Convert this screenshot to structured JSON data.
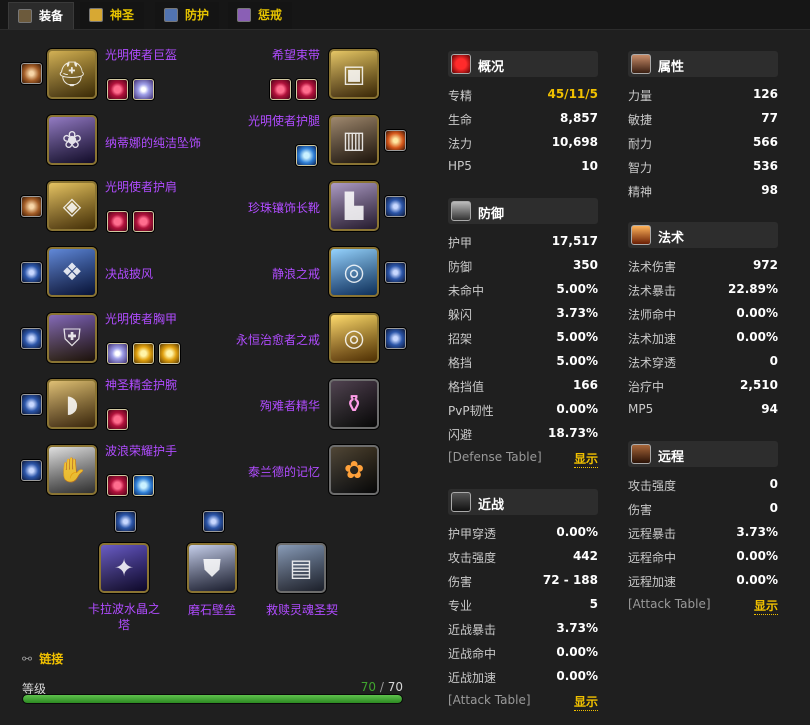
{
  "tabs": [
    {
      "label": "装备",
      "icon": "character-icon",
      "active": true
    },
    {
      "label": "神圣",
      "icon": "holy-icon",
      "active": false
    },
    {
      "label": "防护",
      "icon": "protection-icon",
      "active": false
    },
    {
      "label": "惩戒",
      "icon": "retribution-icon",
      "active": false
    }
  ],
  "equipment": {
    "left": [
      {
        "name": "光明使者巨盔",
        "icon": "helmet-icon"
      },
      {
        "name": "纳蒂娜的纯洁坠饰",
        "icon": "necklace-icon"
      },
      {
        "name": "光明使者护肩",
        "icon": "shoulder-icon"
      },
      {
        "name": "决战披风",
        "icon": "cloak-icon"
      },
      {
        "name": "光明使者胸甲",
        "icon": "chest-icon"
      },
      {
        "name": "神圣精金护腕",
        "icon": "bracer-icon"
      },
      {
        "name": "波浪荣耀护手",
        "icon": "gloves-icon"
      }
    ],
    "right": [
      {
        "name": "希望束带",
        "icon": "belt-icon"
      },
      {
        "name": "光明使者护腿",
        "icon": "legs-icon"
      },
      {
        "name": "珍珠镶饰长靴",
        "icon": "boots-icon"
      },
      {
        "name": "静浪之戒",
        "icon": "ring-icon"
      },
      {
        "name": "永恒治愈者之戒",
        "icon": "ring-icon"
      },
      {
        "name": "殉难者精华",
        "icon": "trinket-icon"
      },
      {
        "name": "泰兰德的记忆",
        "icon": "flower-icon"
      }
    ],
    "weapons": [
      {
        "name": "卡拉波水晶之塔",
        "line1": "卡拉波水晶之",
        "line2": "塔",
        "icon": "mace-icon"
      },
      {
        "name": "磨石壁垒",
        "icon": "shield-icon"
      },
      {
        "name": "救赎灵魂圣契",
        "icon": "libram-icon"
      }
    ]
  },
  "footer": {
    "link_label": "链接",
    "level_label": "等级",
    "level_current": "70",
    "level_sep": " / ",
    "level_max": "70",
    "level_fraction": 1.0
  },
  "stats": {
    "overview": {
      "title": "概况",
      "rows": [
        {
          "label": "专精",
          "value": "45/11/5"
        },
        {
          "label": "生命",
          "value": "8,857"
        },
        {
          "label": "法力",
          "value": "10,698"
        },
        {
          "label": "HP5",
          "value": "10"
        }
      ]
    },
    "defense": {
      "title": "防御",
      "rows": [
        {
          "label": "护甲",
          "value": "17,517"
        },
        {
          "label": "防御",
          "value": "350"
        },
        {
          "label": "未命中",
          "value": "5.00%"
        },
        {
          "label": "躲闪",
          "value": "3.73%"
        },
        {
          "label": "招架",
          "value": "5.00%"
        },
        {
          "label": "格挡",
          "value": "5.00%"
        },
        {
          "label": "格挡值",
          "value": "166"
        },
        {
          "label": "PvP韧性",
          "value": "0.00%"
        },
        {
          "label": "闪避",
          "value": "18.73%"
        }
      ],
      "table_label": "[Defense Table]",
      "show_label": "显示"
    },
    "melee": {
      "title": "近战",
      "rows": [
        {
          "label": "护甲穿透",
          "value": "0.00%"
        },
        {
          "label": "攻击强度",
          "value": "442"
        },
        {
          "label": "伤害",
          "value": "72 - 188"
        },
        {
          "label": "专业",
          "value": "5"
        },
        {
          "label": "近战暴击",
          "value": "3.73%"
        },
        {
          "label": "近战命中",
          "value": "0.00%"
        },
        {
          "label": "近战加速",
          "value": "0.00%"
        }
      ],
      "table_label": "[Attack Table]",
      "show_label": "显示"
    },
    "attributes": {
      "title": "属性",
      "rows": [
        {
          "label": "力量",
          "value": "126"
        },
        {
          "label": "敏捷",
          "value": "77"
        },
        {
          "label": "耐力",
          "value": "566"
        },
        {
          "label": "智力",
          "value": "536"
        },
        {
          "label": "精神",
          "value": "98"
        }
      ]
    },
    "spell": {
      "title": "法术",
      "rows": [
        {
          "label": "法术伤害",
          "value": "972"
        },
        {
          "label": "法术暴击",
          "value": "22.89%"
        },
        {
          "label": "法师命中",
          "value": "0.00%"
        },
        {
          "label": "法术加速",
          "value": "0.00%"
        },
        {
          "label": "法术穿透",
          "value": "0"
        },
        {
          "label": "治疗中",
          "value": "2,510"
        },
        {
          "label": "MP5",
          "value": "94"
        }
      ]
    },
    "ranged": {
      "title": "远程",
      "rows": [
        {
          "label": "攻击强度",
          "value": "0"
        },
        {
          "label": "伤害",
          "value": "0"
        },
        {
          "label": "远程暴击",
          "value": "3.73%"
        },
        {
          "label": "远程命中",
          "value": "0.00%"
        },
        {
          "label": "远程加速",
          "value": "0.00%"
        }
      ],
      "table_label": "[Attack Table]",
      "show_label": "显示"
    }
  },
  "colors": {
    "item_name": "#b04cff",
    "gold": "#f0c000",
    "xp_bar": "#3fa52e"
  }
}
